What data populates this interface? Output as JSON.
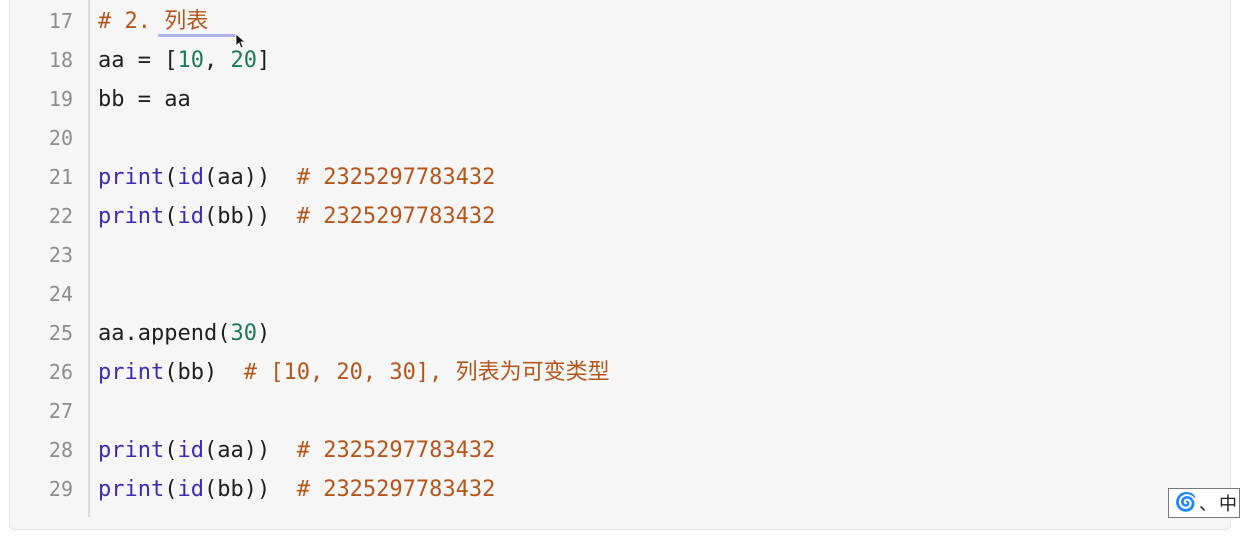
{
  "code_lines": [
    {
      "number": "17",
      "tokens": [
        {
          "text": "# 2. ",
          "style": "comment"
        },
        {
          "text": "列表",
          "style": "comment-cjk"
        }
      ]
    },
    {
      "number": "18",
      "tokens": [
        {
          "text": "aa = [",
          "style": "plain"
        },
        {
          "text": "10",
          "style": "num"
        },
        {
          "text": ", ",
          "style": "plain"
        },
        {
          "text": "20",
          "style": "num"
        },
        {
          "text": "]",
          "style": "plain"
        }
      ]
    },
    {
      "number": "19",
      "tokens": [
        {
          "text": "bb = aa",
          "style": "plain"
        }
      ]
    },
    {
      "number": "20",
      "tokens": []
    },
    {
      "number": "21",
      "tokens": [
        {
          "text": "print",
          "style": "builtin"
        },
        {
          "text": "(",
          "style": "plain"
        },
        {
          "text": "id",
          "style": "builtin"
        },
        {
          "text": "(aa))  ",
          "style": "plain"
        },
        {
          "text": "# 2325297783432",
          "style": "comment"
        }
      ]
    },
    {
      "number": "22",
      "tokens": [
        {
          "text": "print",
          "style": "builtin"
        },
        {
          "text": "(",
          "style": "plain"
        },
        {
          "text": "id",
          "style": "builtin"
        },
        {
          "text": "(bb))  ",
          "style": "plain"
        },
        {
          "text": "# 2325297783432",
          "style": "comment"
        }
      ]
    },
    {
      "number": "23",
      "tokens": []
    },
    {
      "number": "24",
      "tokens": []
    },
    {
      "number": "25",
      "tokens": [
        {
          "text": "aa.append(",
          "style": "plain"
        },
        {
          "text": "30",
          "style": "num"
        },
        {
          "text": ")",
          "style": "plain"
        }
      ]
    },
    {
      "number": "26",
      "tokens": [
        {
          "text": "print",
          "style": "builtin"
        },
        {
          "text": "(bb)  ",
          "style": "plain"
        },
        {
          "text": "# [10, 20, 30], ",
          "style": "comment"
        },
        {
          "text": "列表为可变类型",
          "style": "comment-cjk"
        }
      ]
    },
    {
      "number": "27",
      "tokens": []
    },
    {
      "number": "28",
      "tokens": [
        {
          "text": "print",
          "style": "builtin"
        },
        {
          "text": "(",
          "style": "plain"
        },
        {
          "text": "id",
          "style": "builtin"
        },
        {
          "text": "(aa))  ",
          "style": "plain"
        },
        {
          "text": "# 2325297783432",
          "style": "comment"
        }
      ]
    },
    {
      "number": "29",
      "tokens": [
        {
          "text": "print",
          "style": "builtin"
        },
        {
          "text": "(",
          "style": "plain"
        },
        {
          "text": "id",
          "style": "builtin"
        },
        {
          "text": "(bb))  ",
          "style": "plain"
        },
        {
          "text": "# 2325297783432",
          "style": "comment"
        }
      ]
    }
  ],
  "ime": {
    "icon": "ime-swirl-icon",
    "separator": "、",
    "label": "中"
  },
  "colors": {
    "comment": "#b4561c",
    "number": "#1f7a57",
    "builtin": "#3b2cb5",
    "text": "#1f1f1f",
    "line_number": "#8c8c8c",
    "panel_bg": "#f6f6f6"
  }
}
